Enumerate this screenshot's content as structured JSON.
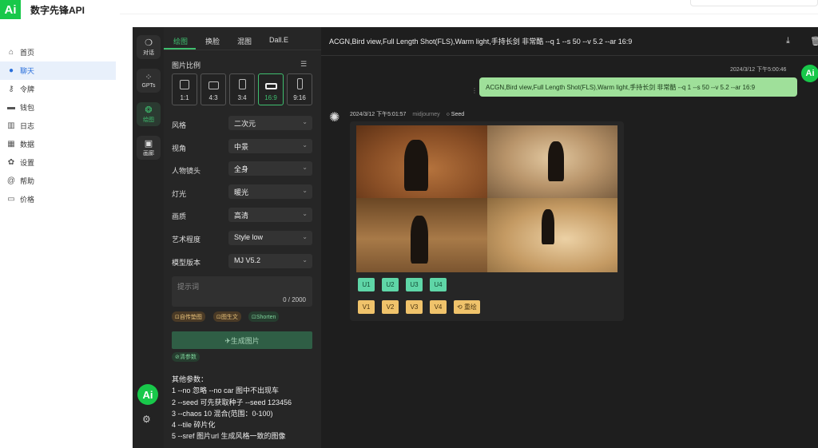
{
  "brand": {
    "logo": "Ai",
    "name": "数字先锋API"
  },
  "nav": [
    {
      "label": "首页",
      "icon": "home-icon",
      "glyph": "⌂",
      "active": false
    },
    {
      "label": "聊天",
      "icon": "chat-icon",
      "glyph": "●",
      "active": true
    },
    {
      "label": "令牌",
      "icon": "key-icon",
      "glyph": "⚷",
      "active": false
    },
    {
      "label": "钱包",
      "icon": "wallet-icon",
      "glyph": "▬",
      "active": false
    },
    {
      "label": "日志",
      "icon": "chart-icon",
      "glyph": "▥",
      "active": false
    },
    {
      "label": "数据",
      "icon": "calendar-icon",
      "glyph": "▦",
      "active": false
    },
    {
      "label": "设置",
      "icon": "gear-icon",
      "glyph": "✿",
      "active": false
    },
    {
      "label": "帮助",
      "icon": "at-icon",
      "glyph": "@",
      "active": false
    },
    {
      "label": "价格",
      "icon": "price-icon",
      "glyph": "▭",
      "active": false
    }
  ],
  "rail": {
    "chat": "对话",
    "gpts": "GPTs",
    "draw": "绘图",
    "gallery": "画廊",
    "avatar": "Ai"
  },
  "panel": {
    "tabs": [
      "绘图",
      "换脸",
      "混图",
      "Dall.E"
    ],
    "ratio_label": "图片比例",
    "ratios": [
      "1:1",
      "4:3",
      "3:4",
      "16:9",
      "9:16"
    ],
    "active_ratio": "16:9",
    "fields": {
      "style": {
        "label": "风格",
        "value": "二次元"
      },
      "view": {
        "label": "视角",
        "value": "中景"
      },
      "shot": {
        "label": "人物镜头",
        "value": "全身"
      },
      "light": {
        "label": "灯光",
        "value": "暖光"
      },
      "quality": {
        "label": "画质",
        "value": "高清"
      },
      "art": {
        "label": "艺术程度",
        "value": "Style low"
      },
      "model": {
        "label": "模型版本",
        "value": "MJ V5.2"
      }
    },
    "prompt_placeholder": "提示词",
    "prompt_count": "0 / 2000",
    "chips": {
      "upload": "⊡自传垫图",
      "img2text": "⊡图生文",
      "shorten": "⊡Shorten"
    },
    "generate": "✈生成图片",
    "clear": "⊘清参数",
    "help_lines": [
      "其他参数：",
      "1 --no 忽略 --no car 图中不出现车",
      "2 --seed 可先获取种子 --seed 123456",
      "3 --chaos 10 混合(范围：0-100)",
      "4 --tile 碎片化",
      "5 --sref 图片url 生成风格一致的图像"
    ]
  },
  "chat": {
    "title": "ACGN,Bird view,Full Length Shot(FLS),Warm light,手持长剑 非常酷 --q 1 --s 50 --v 5.2 --ar 16:9",
    "user_time": "2024/3/12 下午5:00:46",
    "user_avatar": "Ai",
    "user_message": "ACGN,Bird view,Full Length Shot(FLS),Warm light,手持长剑 非常酷 --q 1 --s 50 --v 5.2 --ar 16:9",
    "bot_time": "2024/3/12 下午5:01:57",
    "bot_model": "midjourney",
    "seed_label": "Seed",
    "u_buttons": [
      "U1",
      "U2",
      "U3",
      "U4"
    ],
    "v_buttons": [
      "V1",
      "V2",
      "V3",
      "V4"
    ],
    "redraw": "⟲ 重绘"
  }
}
